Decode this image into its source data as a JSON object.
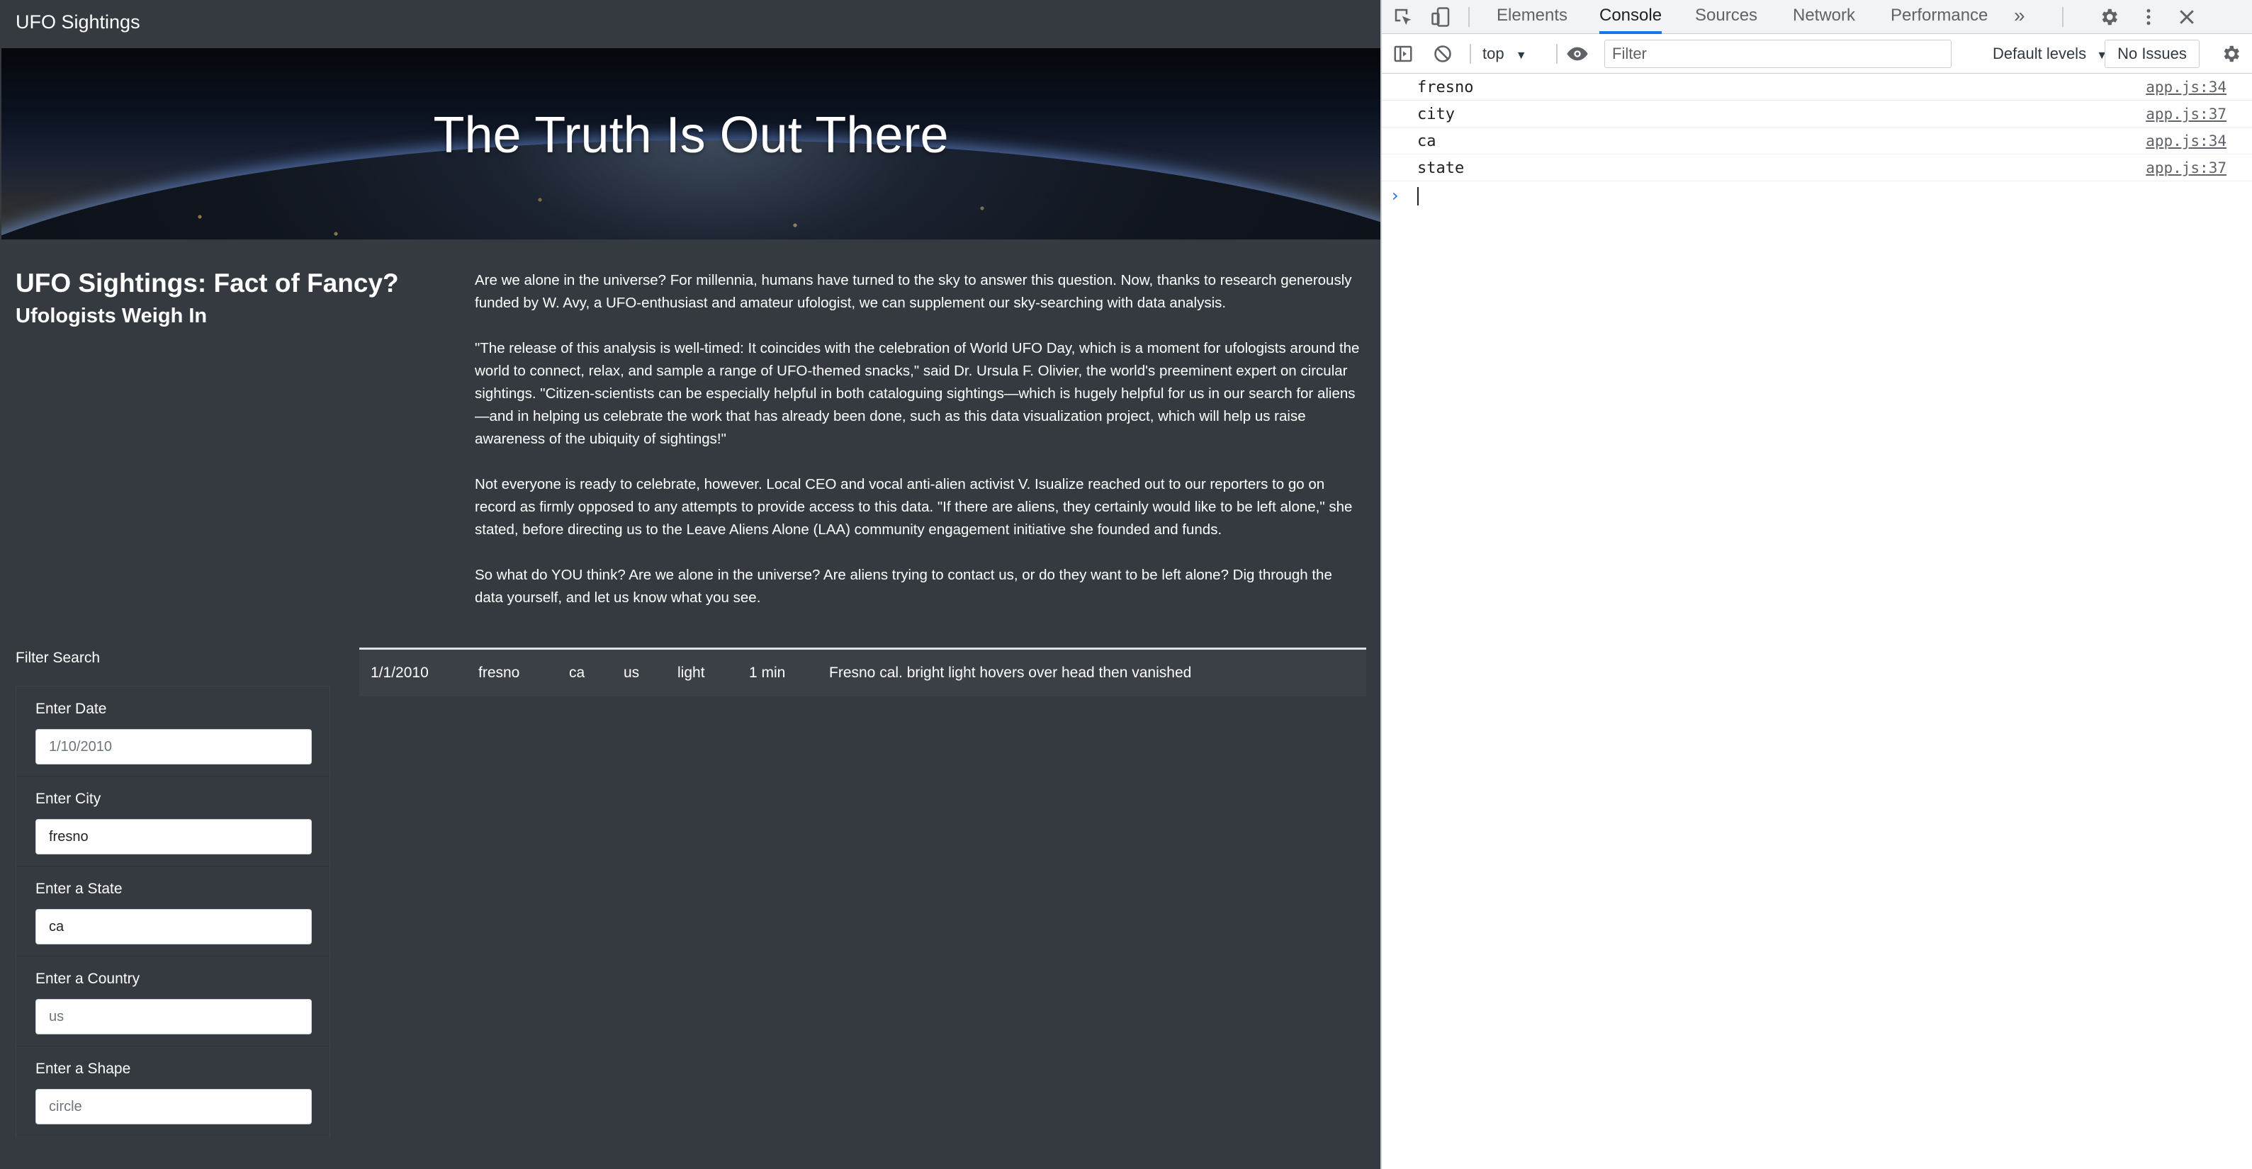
{
  "navbar": {
    "brand": "UFO Sightings"
  },
  "hero": {
    "title": "The Truth Is Out There"
  },
  "article": {
    "title": "UFO Sightings: Fact of Fancy?",
    "subtitle": "Ufologists Weigh In",
    "paragraphs": [
      "Are we alone in the universe? For millennia, humans have turned to the sky to answer this question. Now, thanks to research generously funded by W. Avy, a UFO-enthusiast and amateur ufologist, we can supplement our sky-searching with data analysis.",
      "\"The release of this analysis is well-timed: It coincides with the celebration of World UFO Day, which is a moment for ufologists around the world to connect, relax, and sample a range of UFO-themed snacks,\" said Dr. Ursula F. Olivier, the world's preeminent expert on circular sightings. \"Citizen-scientists can be especially helpful in both cataloguing sightings—which is hugely helpful for us in our search for aliens—and in helping us celebrate the work that has already been done, such as this data visualization project, which will help us raise awareness of the ubiquity of sightings!\"",
      "Not everyone is ready to celebrate, however. Local CEO and vocal anti-alien activist V. Isualize reached out to our reporters to go on record as firmly opposed to any attempts to provide access to this data. \"If there are aliens, they certainly would like to be left alone,\" she stated, before directing us to the Leave Aliens Alone (LAA) community engagement initiative she founded and funds.",
      "So what do YOU think? Are we alone in the universe? Are aliens trying to contact us, or do they want to be left alone? Dig through the data yourself, and let us know what you see."
    ]
  },
  "filters": {
    "title": "Filter Search",
    "items": [
      {
        "label": "Enter Date",
        "value": "",
        "placeholder": "1/10/2010"
      },
      {
        "label": "Enter City",
        "value": "fresno",
        "placeholder": ""
      },
      {
        "label": "Enter a State",
        "value": "ca",
        "placeholder": ""
      },
      {
        "label": "Enter a Country",
        "value": "",
        "placeholder": "us"
      },
      {
        "label": "Enter a Shape",
        "value": "",
        "placeholder": "circle"
      }
    ]
  },
  "results": {
    "rows": [
      {
        "datetime": "1/1/2010",
        "city": "fresno",
        "state": "ca",
        "country": "us",
        "shape": "light",
        "duration": "1 min",
        "comments": "Fresno cal. bright light hovers over head then vanished"
      }
    ]
  },
  "devtools": {
    "tabs": [
      "Elements",
      "Console",
      "Sources",
      "Network",
      "Performance"
    ],
    "active_tab": "Console",
    "more_tabs": "»",
    "context": "top",
    "filter_placeholder": "Filter",
    "levels": "Default levels",
    "issues": "No Issues",
    "console_messages": [
      {
        "text": "fresno",
        "source": "app.js:34"
      },
      {
        "text": "city",
        "source": "app.js:37"
      },
      {
        "text": "ca",
        "source": "app.js:34"
      },
      {
        "text": "state",
        "source": "app.js:37"
      }
    ],
    "icons": {
      "inspect": "inspect-element-icon",
      "device": "device-toolbar-icon",
      "settings": "gear-icon",
      "menu": "kebab-menu-icon",
      "close": "close-icon",
      "sidebar": "console-sidebar-icon",
      "clear": "clear-console-icon",
      "eye": "live-expression-icon"
    },
    "accent": "#1a73e8"
  }
}
